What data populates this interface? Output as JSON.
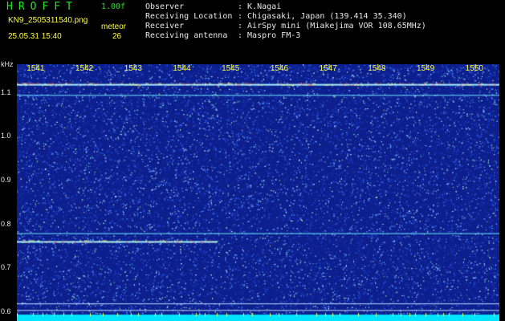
{
  "app": {
    "logo": "HROFFT",
    "version": "1.00f",
    "filename": "KN9_2505311540.png",
    "meteor_label": "meteor",
    "datetime": "25.05.31 15:40",
    "meteor_count": "26"
  },
  "info": [
    {
      "label": "Observer",
      "value": ": K.Nagai"
    },
    {
      "label": "Receiving Location",
      "value": ": Chigasaki, Japan (139.414 35.340)"
    },
    {
      "label": "Receiver",
      "value": ": AirSpy mini (Miakejima VOR 108.65MHz)"
    },
    {
      "label": "Receiving antenna",
      "value": ": Maspro FM-3"
    }
  ],
  "axes": {
    "y_unit": "kHz",
    "y_ticks": [
      "1.1",
      "1.0",
      "0.9",
      "0.8",
      "0.7",
      "0.6"
    ],
    "y_range": [
      0.58,
      1.165
    ],
    "x_ticks": [
      "1541",
      "1542",
      "1543",
      "1544",
      "1545",
      "1546",
      "1547",
      "1548",
      "1549",
      "1550"
    ],
    "x_range": [
      1540.6,
      1550.5
    ]
  },
  "colors": {
    "background": "#0d1f8c",
    "noise_low": "#1b3fd6",
    "noise_high": "#8ecbff",
    "signal_line": "#9ef2ff",
    "hot": "#ff4040",
    "baseline": "#00e5ff",
    "tick_yellow": "#ffff40"
  }
}
